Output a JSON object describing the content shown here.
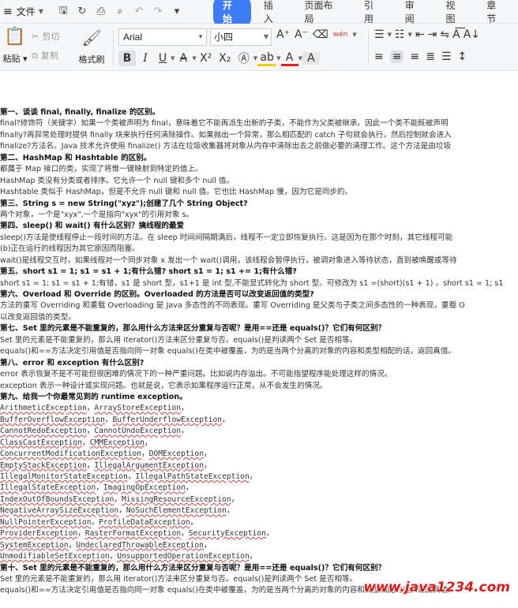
{
  "menubar": {
    "file_label": "文件",
    "tabs": [
      "开始",
      "插入",
      "页面布局",
      "引用",
      "审阅",
      "视图",
      "章节"
    ]
  },
  "ribbon": {
    "paste_label": "粘贴",
    "cut_label": "剪切",
    "copy_label": "复制",
    "format_painter_label": "格式刷",
    "font_name": "Arial",
    "font_size": "小四",
    "pinyin_label": "wén"
  },
  "document": {
    "lines": [
      {
        "b": true,
        "t": "第一、谈谈 final, finally, finalize 的区别。"
      },
      {
        "t": "final?修饰符（关键字）如果一个类被声明为 final，意味着它不能再派生出新的子类，不能作为父类被继承。因此一个类不能既被声明"
      },
      {
        "t": "finally?再异常处理时提供 finally 块来执行任何清除操作。如果抛出一个异常，那么相匹配的 catch 子句就会执行，然后控制就会进入"
      },
      {
        "t": "finalize?方法名。Java 技术允许使用 finalize() 方法在垃圾收集器将对象从内存中清除出去之前做必要的清理工作。这个方法是由垃圾"
      },
      {
        "b": true,
        "t": "第二、HashMap 和 Hashtable 的区别。"
      },
      {
        "t": "都属于 Map 接口的类，实现了将惟一键映射到特定的值上。"
      },
      {
        "t": "HashMap 类没有分类或者排序。它允许一个 null 键和多个 null 值。"
      },
      {
        "t": "Hashtable 类似于 HashMap，但是不允许 null 键和 null 值。它也比 HashMap 慢，因为它是同步的。"
      },
      {
        "b": true,
        "t": "第三、String s = new String(\"xyz\");创建了几个 String Object?"
      },
      {
        "t": "两个对象，一个是\"xyx\",一个是指向\"xyx\"的引用对象 s。"
      },
      {
        "b": true,
        "t": "第四、sleep() 和 wait() 有什么区别？搞线程的最爱"
      },
      {
        "t": "sleep()方法是使线程停止一段时间的方法。在 sleep 时间间隔期满后，线程不一定立即恢复执行。这是因为在那个时刻，其它线程可能"
      },
      {
        "t": "(b)正在运行的线程因为其它原因而阻塞。"
      },
      {
        "t": "wait()是线程交互时，如果线程对一个同步对象 x 发出一个 wait()调用，该线程会暂停执行，被调对象进入等待状态，直到被唤醒或等待"
      },
      {
        "b": true,
        "t": "第五、short s1 = 1; s1 = s1 + 1;有什么错? short s1 = 1; s1 += 1;有什么错?"
      },
      {
        "t": "short s1 = 1; s1 = s1 + 1;有错，s1 是 short 型，s1+1 是 int 型,不能显式转化为 short 型。可修改为 s1 =(short)(s1 + 1) 。short s1 = 1; s1"
      },
      {
        "b": true,
        "t": "第六、Overload 和 Override 的区别。Overloaded 的方法是否可以改变返回值的类型?"
      },
      {
        "t": "方法的重写 Overriding 和重载 Overloading 是 Java 多态性的不同表现。重写 Overriding 是父类与子类之间多态性的一种表现，重载 O"
      },
      {
        "t": "以改变返回值的类型。"
      },
      {
        "b": true,
        "t": "第七、Set 里的元素是不能重复的，那么用什么方法来区分重复与否呢？是用==还是 equals()？它们有何区别？"
      },
      {
        "t": "Set 里的元素是不能重复的，那么用 iterator()方法来区分重复与否。equals()是判读两个 Set 是否相等。"
      },
      {
        "t": "equals()和==方法决定引用值是否指向同一对象 equals()在类中被覆盖，为的是当两个分离的对象的内容和类型相配的话，返回真值。"
      },
      {
        "b": true,
        "t": "第八、error 和 exception 有什么区别?"
      },
      {
        "t": "error 表示恢复不是不可能但很困难的情况下的一种严重问题。比如说内存溢出。不可能指望程序能处理这样的情况。"
      },
      {
        "t": "exception 表示一种设计或实现问题。也就是说，它表示如果程序运行正常，从不会发生的情况。"
      },
      {
        "b": true,
        "t": "第九、给我一个你最常见到的 runtime exception。"
      },
      {
        "m": [
          "ArithmeticException",
          "ArrayStoreException"
        ]
      },
      {
        "m": [
          "BufferOverflowException",
          "BufferUnderflowException"
        ]
      },
      {
        "m": [
          "CannotRedoException",
          "CannotUndoException"
        ]
      },
      {
        "m": [
          "ClassCastException",
          "CMMException"
        ]
      },
      {
        "m": [
          "ConcurrentModificationException",
          "DOMException"
        ]
      },
      {
        "m": [
          "EmptyStackException",
          "IllegalArgumentException"
        ]
      },
      {
        "m": [
          "IllegalMonitorStateException",
          "IllegalPathStateException"
        ]
      },
      {
        "m": [
          "IllegalStateException",
          "ImagingOpException"
        ]
      },
      {
        "m": [
          "IndexOutOfBoundsException",
          "MissingResourceException"
        ]
      },
      {
        "m": [
          "NegativeArraySizeException",
          "NoSuchElementException"
        ]
      },
      {
        "m": [
          "NullPointerException",
          "ProfileDataException"
        ]
      },
      {
        "m": [
          "ProviderException",
          "RasterFormatException",
          "SecurityException"
        ]
      },
      {
        "m": [
          "SystemException",
          "UndeclaredThrowableException"
        ]
      },
      {
        "m": [
          "UnmodifiableSetException",
          "UnsupportedOperationException"
        ]
      },
      {
        "b": true,
        "t": "第十、Set 里的元素是不能重复的，那么用什么方法来区分重复与否呢？是用==还是 equals()？它们有何区别？"
      },
      {
        "t": "Set 里的元素是不能重复的，那么用 iterator()方法来区分重复与否。equals()是判读两个 Set 是否相等。"
      },
      {
        "t": "equals()和==方法决定引用值是否指向同一对象 equals()在类中被覆盖，为的是当两个分离的对象的内容和类型相配的话，返回真值。"
      }
    ],
    "watermark": "www.java1234.com"
  }
}
